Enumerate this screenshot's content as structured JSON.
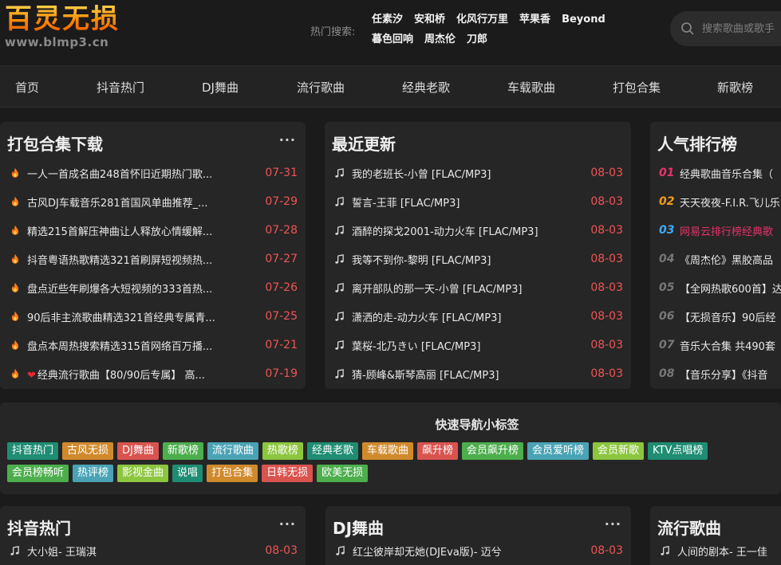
{
  "header": {
    "logo_title": "百灵无损",
    "logo_sub": "www.blmp3.cn",
    "hot_label": "热门搜索:",
    "hot_words": [
      "任素汐",
      "安和桥",
      "化风行万里",
      "苹果香",
      "Beyond",
      "暮色回响",
      "周杰伦",
      "刀郎"
    ],
    "search_placeholder": "搜索歌曲或歌手"
  },
  "nav": [
    "首页",
    "抖音热门",
    "DJ舞曲",
    "流行歌曲",
    "经典老歌",
    "车载歌曲",
    "打包合集",
    "新歌榜"
  ],
  "cards": {
    "collection": {
      "title": "打包合集下载",
      "more": "···",
      "items": [
        {
          "text": "一人一首成名曲248首怀旧近期热门歌...",
          "date": "07-31",
          "heart": false
        },
        {
          "text": "古风DJ车载音乐281首国风单曲推荐_...",
          "date": "07-29",
          "heart": false
        },
        {
          "text": "精选215首解压神曲让人释放心情缓解...",
          "date": "07-28",
          "heart": false
        },
        {
          "text": "抖音粤语热歌精选321首刷屏短视频热...",
          "date": "07-27",
          "heart": false
        },
        {
          "text": "盘点近些年刷爆各大短视频的333首热...",
          "date": "07-26",
          "heart": false
        },
        {
          "text": "90后非主流歌曲精选321首经典专属青...",
          "date": "07-25",
          "heart": false
        },
        {
          "text": "盘点本周热搜索精选315首网络百万播...",
          "date": "07-21",
          "heart": false
        },
        {
          "text": "经典流行歌曲【80/90后专属】 高...",
          "date": "07-19",
          "heart": true
        }
      ]
    },
    "recent": {
      "title": "最近更新",
      "items": [
        {
          "text": "我的老班长-小曾 [FLAC/MP3]",
          "date": "08-03"
        },
        {
          "text": "誓言-王菲 [FLAC/MP3]",
          "date": "08-03"
        },
        {
          "text": "酒醉的探戈2001-动力火车 [FLAC/MP3]",
          "date": "08-03"
        },
        {
          "text": "我等不到你-黎明 [FLAC/MP3]",
          "date": "08-03"
        },
        {
          "text": "离开部队的那一天-小曾 [FLAC/MP3]",
          "date": "08-03"
        },
        {
          "text": "潇洒的走-动力火车 [FLAC/MP3]",
          "date": "08-03"
        },
        {
          "text": "葉桜-北乃きい [FLAC/MP3]",
          "date": "08-03"
        },
        {
          "text": "猜-顾峰&斯琴高丽 [FLAC/MP3]",
          "date": "08-03"
        }
      ]
    },
    "ranking": {
      "title": "人气排行榜",
      "items": [
        {
          "num": "01",
          "text": "经典歌曲音乐合集（"
        },
        {
          "num": "02",
          "text": "天天夜夜-F.I.R.飞儿乐"
        },
        {
          "num": "03",
          "text": "网易云排行榜经典歌"
        },
        {
          "num": "04",
          "text": "《周杰伦》黑胶高品"
        },
        {
          "num": "05",
          "text": "【全网热歌600首】达"
        },
        {
          "num": "06",
          "text": "【无损音乐】90后经"
        },
        {
          "num": "07",
          "text": "音乐大合集 共490套"
        },
        {
          "num": "08",
          "text": "【音乐分享】《抖音"
        }
      ]
    },
    "douyin": {
      "title": "抖音热门",
      "items": [
        {
          "text": "大小姐- 王瑞淇",
          "date": "08-03"
        }
      ]
    },
    "dj": {
      "title": "DJ舞曲",
      "items": [
        {
          "text": "红尘彼岸却无她(DJEva版)- 迈兮",
          "date": "08-03"
        }
      ]
    },
    "pop": {
      "title": "流行歌曲",
      "items": [
        {
          "text": "人间的剧本- 王一佳",
          "date": ""
        }
      ]
    }
  },
  "tags": {
    "title": "快速导航小标签",
    "line1": [
      {
        "label": "抖音热门",
        "color": "#1e8d72"
      },
      {
        "label": "古风无损",
        "color": "#d08a2c"
      },
      {
        "label": "DJ舞曲",
        "color": "#d9534f"
      },
      {
        "label": "新歌榜",
        "color": "#4cae4c"
      },
      {
        "label": "流行歌曲",
        "color": "#4aa3b5"
      },
      {
        "label": "热歌榜",
        "color": "#8cc63f"
      },
      {
        "label": "经典老歌",
        "color": "#1e8d72"
      },
      {
        "label": "车载歌曲",
        "color": "#d08a2c"
      },
      {
        "label": "飙升榜",
        "color": "#d9534f"
      },
      {
        "label": "会员飙升榜",
        "color": "#4cae4c"
      },
      {
        "label": "会员爱听榜",
        "color": "#4aa3b5"
      },
      {
        "label": "会员新歌",
        "color": "#8cc63f"
      },
      {
        "label": "KTV点唱榜",
        "color": "#1e8d72"
      }
    ],
    "line2": [
      {
        "label": "会员榜畅听",
        "color": "#4cae4c"
      },
      {
        "label": "热评榜",
        "color": "#4aa3b5"
      },
      {
        "label": "影视金曲",
        "color": "#8cc63f"
      },
      {
        "label": "说唱",
        "color": "#1e8d72"
      },
      {
        "label": "打包合集",
        "color": "#d08a2c"
      },
      {
        "label": "日韩无损",
        "color": "#d9534f"
      },
      {
        "label": "欧美无损",
        "color": "#4cae4c"
      }
    ]
  },
  "colors": {
    "date": "#f05454",
    "rank1": "#e8326a",
    "rank2": "#f39c12",
    "rank3": "#3fa9f5",
    "rank_other": "#777777"
  },
  "icons": {
    "collection_item": "fire-icon",
    "song_item": "music-note-icon",
    "search": "search-icon",
    "heart": "heart-icon"
  }
}
